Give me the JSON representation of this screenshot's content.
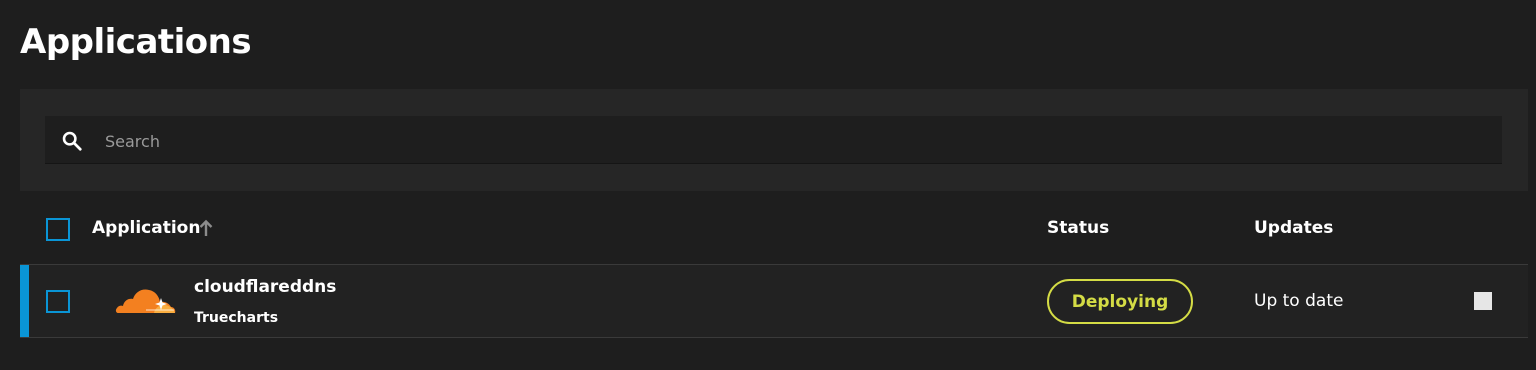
{
  "page": {
    "title": "Applications"
  },
  "search": {
    "placeholder": "Search",
    "value": ""
  },
  "table": {
    "columns": {
      "application": "Application",
      "status": "Status",
      "updates": "Updates"
    },
    "sort": {
      "column": "application",
      "direction": "ascending",
      "icon": "arrow-up-icon"
    },
    "rows": [
      {
        "name": "cloudflareddns",
        "train": "Truecharts",
        "status": "Deploying",
        "updates": "Up to date",
        "logo": "cloudflare-logo",
        "checked": false
      }
    ]
  },
  "colors": {
    "background": "#1e1e1e",
    "panel": "#262626",
    "accent": "#0a95d6",
    "deploying": "#d4dc45",
    "cloudflare_orange": "#f38020"
  }
}
